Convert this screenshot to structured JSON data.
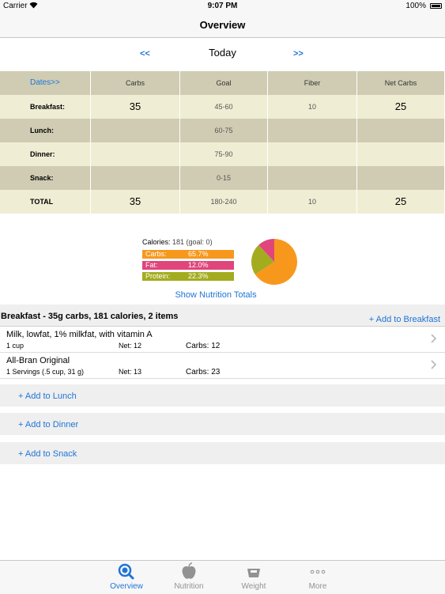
{
  "status_bar": {
    "carrier": "Carrier",
    "time": "9:07 PM",
    "battery": "100%"
  },
  "nav": {
    "title": "Overview"
  },
  "date_nav": {
    "prev": "<<",
    "label": "Today",
    "next": ">>"
  },
  "table": {
    "headers": [
      "Dates>>",
      "Carbs",
      "Goal",
      "Fiber",
      "Net Carbs"
    ],
    "rows": [
      {
        "meal": "Breakfast:",
        "carbs": "35",
        "goal": "45-60",
        "fiber": "10",
        "net": "25"
      },
      {
        "meal": "Lunch:",
        "carbs": "",
        "goal": "60-75",
        "fiber": "",
        "net": ""
      },
      {
        "meal": "Dinner:",
        "carbs": "",
        "goal": "75-90",
        "fiber": "",
        "net": ""
      },
      {
        "meal": "Snack:",
        "carbs": "",
        "goal": "0-15",
        "fiber": "",
        "net": ""
      },
      {
        "meal": "TOTAL",
        "carbs": "35",
        "goal": "180-240",
        "fiber": "10",
        "net": "25"
      }
    ]
  },
  "nutrition": {
    "calories_label": "Calories:",
    "calories_value": "181 (goal: 0)",
    "carbs_label": "Carbs:",
    "carbs_pct": "65.7%",
    "fat_label": "Fat:",
    "fat_pct": "12.0%",
    "protein_label": "Protein:",
    "protein_pct": "22.3%",
    "pie": [
      {
        "label": "Carbs",
        "fraction": 0.657,
        "color": "#f7981d"
      },
      {
        "label": "Fat",
        "fraction": 0.12,
        "color": "#e0457b"
      },
      {
        "label": "Protein",
        "fraction": 0.223,
        "color": "#a3ac1f"
      }
    ],
    "show_totals": "Show Nutrition Totals"
  },
  "breakfast": {
    "title": "Breakfast - 35g carbs, 181 calories, 2 items",
    "add_label": "+ Add to Breakfast",
    "items": [
      {
        "name": "Milk, lowfat, 1% milkfat, with vitamin A",
        "qty": "1 cup",
        "net": "Net: 12",
        "carbs": "Carbs: 12"
      },
      {
        "name": "All-Bran Original",
        "qty": "1 Servings (.5 cup, 31 g)",
        "net": "Net: 13",
        "carbs": "Carbs: 23"
      }
    ]
  },
  "add_rows": {
    "lunch": "+ Add to Lunch",
    "dinner": "+ Add to Dinner",
    "snack": "+ Add to Snack"
  },
  "tabs": [
    {
      "label": "Overview",
      "active": true
    },
    {
      "label": "Nutrition",
      "active": false
    },
    {
      "label": "Weight",
      "active": false
    },
    {
      "label": "More",
      "active": false
    }
  ],
  "colors": {
    "accent": "#1f74d6",
    "table_dark": "#cfccb3",
    "table_light": "#efedd4"
  }
}
